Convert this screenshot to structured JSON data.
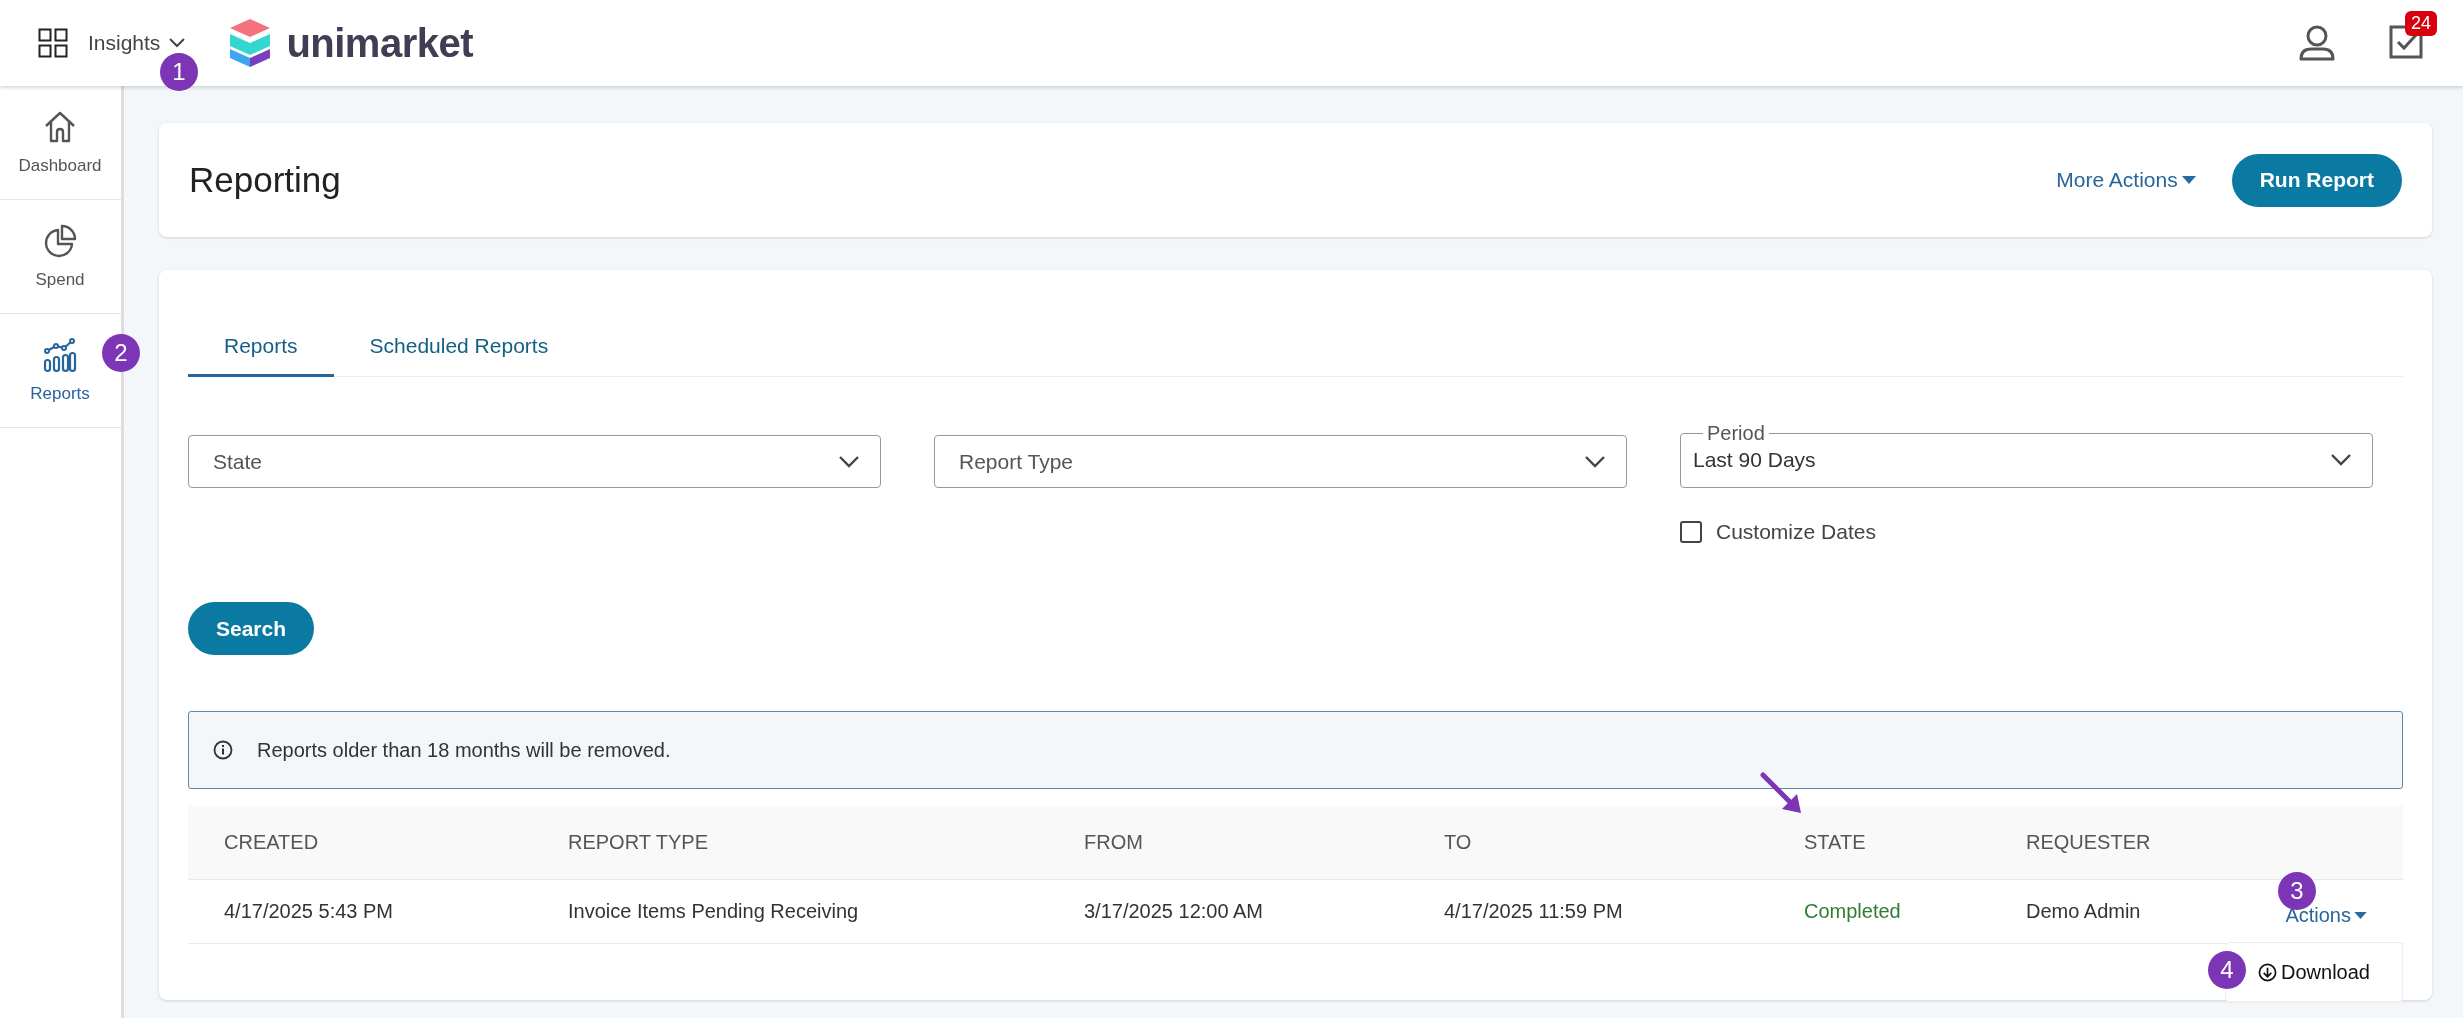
{
  "header": {
    "app_switcher": {
      "label": "Insights",
      "marker": "1"
    },
    "logo": {
      "text": "unimarket"
    },
    "tasks_badge": "24"
  },
  "sidebar": {
    "items": [
      {
        "label": "Dashboard",
        "selected": false
      },
      {
        "label": "Spend",
        "selected": false
      },
      {
        "label": "Reports",
        "selected": true,
        "marker": "2"
      }
    ]
  },
  "page_header": {
    "title": "Reporting",
    "more_actions": "More Actions",
    "run_report": "Run Report"
  },
  "tabs": [
    {
      "label": "Reports",
      "selected": true
    },
    {
      "label": "Scheduled Reports",
      "selected": false
    }
  ],
  "filters": [
    {
      "kind": "select",
      "placeholder": "State"
    },
    {
      "kind": "select",
      "placeholder": "Report Type"
    },
    {
      "kind": "floating",
      "label": "Period",
      "value": "Last 90 Days"
    }
  ],
  "customize_dates": {
    "label": "Customize Dates",
    "checked": false
  },
  "search_button": "Search",
  "notice": "Reports older than 18 months will be removed.",
  "table": {
    "columns": [
      {
        "label": "CREATED"
      },
      {
        "label": "REPORT TYPE"
      },
      {
        "label": "FROM"
      },
      {
        "label": "TO"
      },
      {
        "label": "STATE",
        "arrow": true
      },
      {
        "label": "REQUESTER"
      }
    ],
    "rows": [
      {
        "cells": [
          {
            "text": "4/17/2025 5:43 PM",
            "kind": "text"
          },
          {
            "text": "Invoice Items Pending Receiving",
            "kind": "text"
          },
          {
            "text": "3/17/2025 12:00 AM",
            "kind": "text"
          },
          {
            "text": "4/17/2025 11:59 PM",
            "kind": "text"
          },
          {
            "text": "Completed",
            "kind": "status"
          },
          {
            "text": "Demo Admin",
            "kind": "text"
          }
        ],
        "actions": {
          "label": "Actions",
          "marker": "3",
          "menu": [
            {
              "label": "Download",
              "marker": "4"
            }
          ]
        }
      }
    ]
  }
}
